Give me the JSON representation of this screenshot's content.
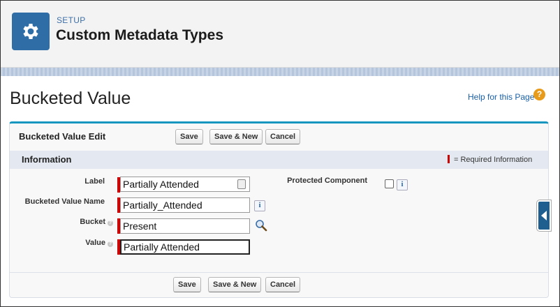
{
  "header": {
    "eyebrow": "SETUP",
    "title": "Custom Metadata Types",
    "icon": "gear-icon"
  },
  "page": {
    "title": "Bucketed Value",
    "help_label": "Help for this Page",
    "help_icon": "question-icon"
  },
  "edit": {
    "title": "Bucketed Value Edit",
    "buttons": {
      "save": "Save",
      "save_new": "Save & New",
      "cancel": "Cancel"
    }
  },
  "section": {
    "title": "Information",
    "required_legend": "= Required Information"
  },
  "fields": {
    "label": {
      "label": "Label",
      "value": "Partially Attended"
    },
    "name": {
      "label": "Bucketed Value Name",
      "value": "Partially_Attended"
    },
    "bucket": {
      "label": "Bucket",
      "value": "Present"
    },
    "value": {
      "label": "Value",
      "value": "Partially Attended"
    },
    "protected": {
      "label": "Protected Component",
      "checked": false
    }
  },
  "colors": {
    "brand": "#2f6da6",
    "required": "#cc0000",
    "accent": "#1797c0"
  }
}
